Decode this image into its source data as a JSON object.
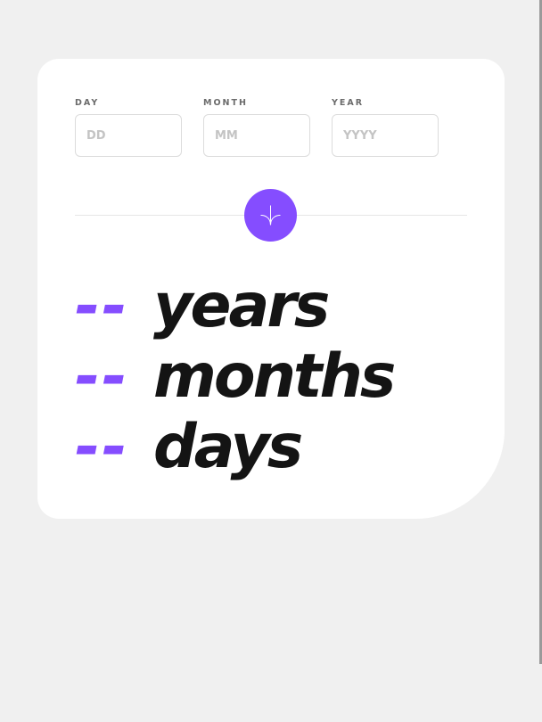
{
  "colors": {
    "accent": "#854dff",
    "text": "#141414",
    "label": "#6b6b6b",
    "border": "#dcdcdc",
    "page_background": "#f0f0f0",
    "card_background": "#ffffff"
  },
  "form": {
    "day": {
      "label": "DAY",
      "placeholder": "DD",
      "value": ""
    },
    "month": {
      "label": "MONTH",
      "placeholder": "MM",
      "value": ""
    },
    "year": {
      "label": "YEAR",
      "placeholder": "YYYY",
      "value": ""
    },
    "submit_icon": "arrow-down-icon"
  },
  "results": {
    "years": {
      "value": "--",
      "unit": "years"
    },
    "months": {
      "value": "--",
      "unit": "months"
    },
    "days": {
      "value": "--",
      "unit": "days"
    }
  }
}
